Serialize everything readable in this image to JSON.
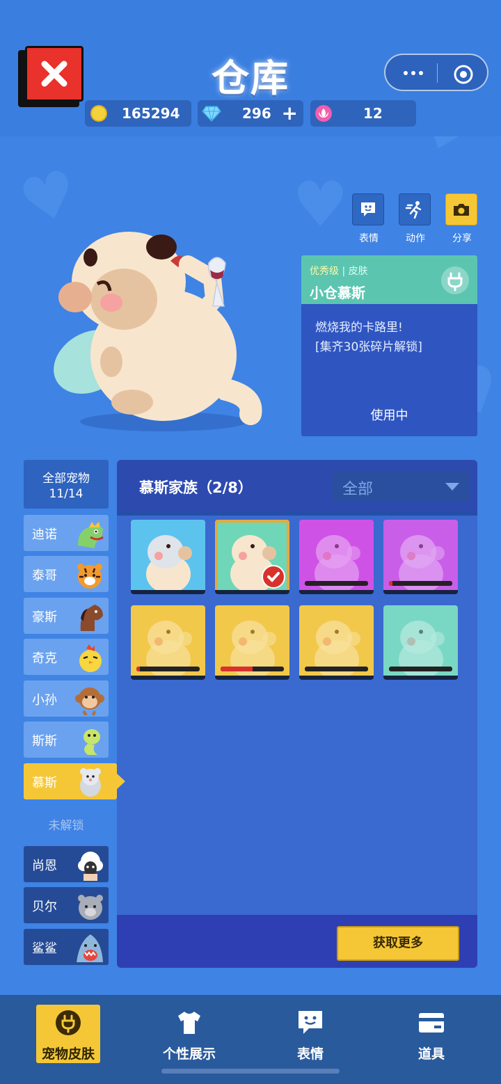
{
  "header": {
    "title": "仓库",
    "coins": "165294",
    "diamonds": "296",
    "petals": "12"
  },
  "actions": [
    {
      "label": "表情"
    },
    {
      "label": "动作"
    },
    {
      "label": "分享"
    }
  ],
  "skin_card": {
    "grade": "优秀级",
    "type": "皮肤",
    "name": "小仓慕斯",
    "desc_line1": "燃烧我的卡路里!",
    "desc_line2": "[集齐30张碎片解锁]",
    "status": "使用中"
  },
  "pet_list": {
    "all_label": "全部宠物",
    "all_count": "11/14",
    "unlocked": [
      {
        "name": "迪诺"
      },
      {
        "name": "泰哥"
      },
      {
        "name": "豪斯"
      },
      {
        "name": "奇克"
      },
      {
        "name": "小孙"
      },
      {
        "name": "斯斯"
      },
      {
        "name": "慕斯",
        "selected": true
      }
    ],
    "locked_label": "未解锁",
    "locked": [
      {
        "name": "尚恩"
      },
      {
        "name": "贝尔"
      },
      {
        "name": "鲨鲨"
      }
    ]
  },
  "skins_panel": {
    "title": "慕斯家族（2/8）",
    "filter": "全部",
    "get_more": "获取更多",
    "items": [
      {
        "color": "#5cc3ef",
        "owned": true,
        "progress": 1.0
      },
      {
        "color": "#6fd6b8",
        "owned": true,
        "selected": true,
        "progress": 1.0
      },
      {
        "color": "#cf52e6",
        "owned": false,
        "progress": 0.0
      },
      {
        "color": "#c95ee8",
        "owned": false,
        "progress": 0.05
      },
      {
        "color": "#f2c84b",
        "owned": false,
        "progress": 0.06
      },
      {
        "color": "#f2c84b",
        "owned": false,
        "progress": 0.5
      },
      {
        "color": "#f2c84b",
        "owned": false,
        "progress": 0.0
      },
      {
        "color": "#79d8c4",
        "owned": false,
        "progress": 0.0
      }
    ]
  },
  "bottom_nav": [
    {
      "label": "宠物皮肤",
      "active": true
    },
    {
      "label": "个性展示"
    },
    {
      "label": "表情"
    },
    {
      "label": "道具"
    }
  ]
}
